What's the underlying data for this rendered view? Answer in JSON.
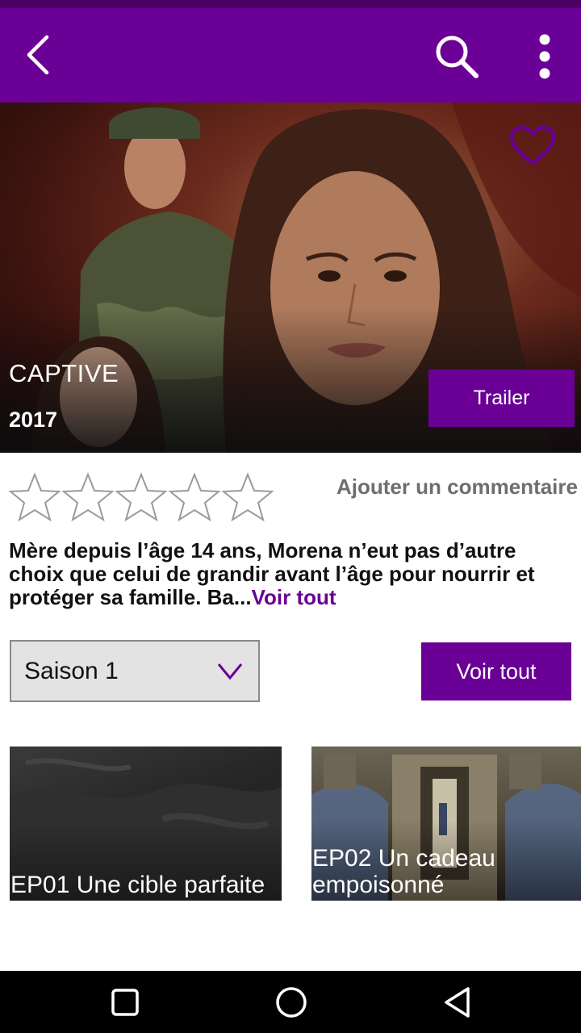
{
  "app_bar": {
    "back_icon": "chevron-left-icon",
    "search_icon": "search-icon",
    "menu_icon": "more-vertical-icon",
    "background": "#6a0096"
  },
  "hero": {
    "title": "CAPTIVE",
    "year": "2017",
    "favorite_icon": "heart-outline-icon",
    "trailer_label": "Trailer"
  },
  "rating": {
    "stars_filled": 0,
    "stars_total": 5,
    "add_comment_label": "Ajouter un commentaire"
  },
  "synopsis": {
    "text": "Mère depuis l’âge 14 ans, Morena n’eut pas d’autre choix que celui de grandir avant l’âge pour nourrir et protéger sa famille. Ba...",
    "more_label": "Voir tout"
  },
  "season": {
    "selected": "Saison 1",
    "see_all_label": "Voir tout"
  },
  "episodes": [
    {
      "title": "EP01 Une cible parfaite"
    },
    {
      "title": "EP02 Un cadeau empoisonné"
    }
  ],
  "colors": {
    "accent": "#6a0096",
    "secondary_text": "#6e6e6e"
  },
  "nav": {
    "recent_icon": "square-icon",
    "home_icon": "circle-icon",
    "back_icon": "triangle-back-icon"
  }
}
